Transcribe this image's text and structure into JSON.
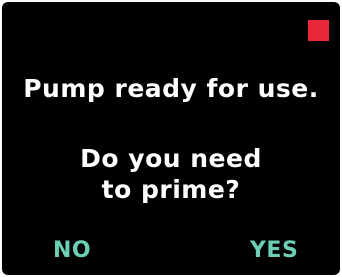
{
  "screen": {
    "status_indicator_color": "#e8283a",
    "message": "Pump ready for use.",
    "question_line_1": "Do you need",
    "question_line_2": "to prime?"
  },
  "soft_keys": {
    "no_label": "NO",
    "yes_label": "YES",
    "color": "#6ccfb3"
  }
}
